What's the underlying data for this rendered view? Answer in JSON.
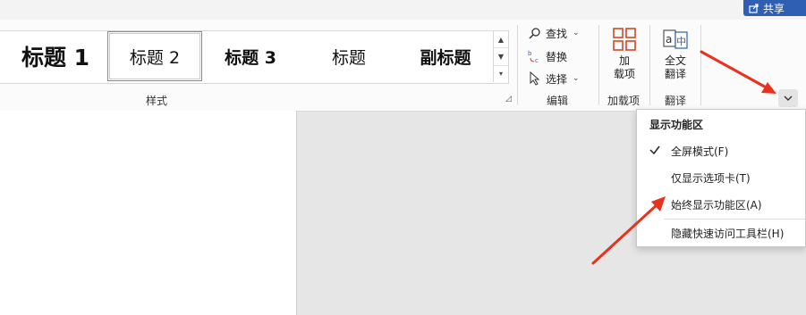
{
  "share": {
    "label": "共享"
  },
  "styles": {
    "items": [
      "标题 1",
      "标题 2",
      "标题 3",
      "标题",
      "副标题"
    ],
    "group_label": "样式"
  },
  "editing": {
    "find_label": "查找",
    "replace_label": "替换",
    "select_label": "选择",
    "group_label": "编辑"
  },
  "addins": {
    "button_label_line1": "加",
    "button_label_line2": "载项",
    "group_label": "加载项"
  },
  "translate": {
    "button_label_line1": "全文",
    "button_label_line2": "翻译",
    "group_label": "翻译"
  },
  "ribbon_menu": {
    "header": "显示功能区",
    "items": [
      {
        "label": "全屏模式(F)",
        "checked": true
      },
      {
        "label": "仅显示选项卡(T)",
        "checked": false
      },
      {
        "label": "始终显示功能区(A)",
        "checked": false
      },
      {
        "label": "隐藏快速访问工具栏(H)",
        "checked": false
      }
    ]
  },
  "colors": {
    "accent": "#2f5fb3",
    "annotation_arrow": "#e8321e",
    "addins_icon": "#d24726"
  }
}
